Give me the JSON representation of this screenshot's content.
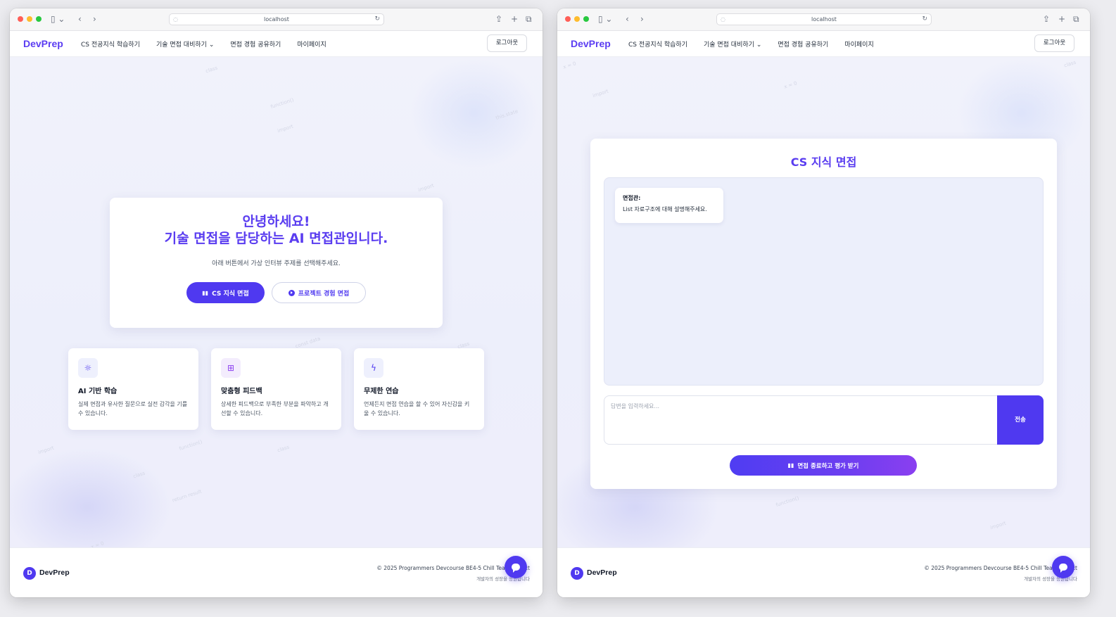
{
  "browser": {
    "address": "localhost",
    "icons": {
      "sidebar": "sidebar-icon",
      "back": "back-icon",
      "forward": "forward-icon",
      "share": "share-icon",
      "new_tab": "plus-icon",
      "tabs": "tabs-icon",
      "reload": "reload-icon"
    }
  },
  "nav": {
    "logo": "DevPrep",
    "items": [
      "CS 전공지식 학습하기",
      "기술 면접 대비하기",
      "면접 경험 공유하기",
      "마이페이지"
    ],
    "logout": "로그아웃"
  },
  "home": {
    "title_line1": "안녕하세요!",
    "title_line2": "기술 면접을 담당하는 AI 면접관입니다.",
    "subtitle": "아래 버튼에서 가상 인터뷰 주제를 선택해주세요.",
    "btn_cs": "CS 지식 면접",
    "btn_project": "프로젝트 경험 면접",
    "features": [
      {
        "title": "AI 기반 학습",
        "desc": "실제 면접과 유사한 질문으로 실전 감각을 기를 수 있습니다.",
        "icon": "lightbulb-icon"
      },
      {
        "title": "맞춤형 피드백",
        "desc": "상세한 피드백으로 부족한 부분을 파악하고 개선할 수 있습니다.",
        "icon": "book-icon"
      },
      {
        "title": "무제한 연습",
        "desc": "언제든지 면접 연습을 할 수 있어 자신감을 키울 수 있습니다.",
        "icon": "lightning-icon"
      }
    ]
  },
  "interview": {
    "title": "CS 지식 면접",
    "message_sender": "면접관:",
    "message_text": "List 자료구조에 대해 설명해주세요.",
    "input_placeholder": "답변을 입력하세요...",
    "send": "전송",
    "end": "면접 종료하고 평가 받기"
  },
  "footer": {
    "logo_letter": "D",
    "logo": "DevPrep",
    "copyright": "© 2025 Programmers Devcourse BE4-5 Chill Team Project",
    "sub": "개발자의 성장을 응원합니다"
  },
  "colors": {
    "accent": "#4f39f0",
    "title": "#5a3df0"
  }
}
